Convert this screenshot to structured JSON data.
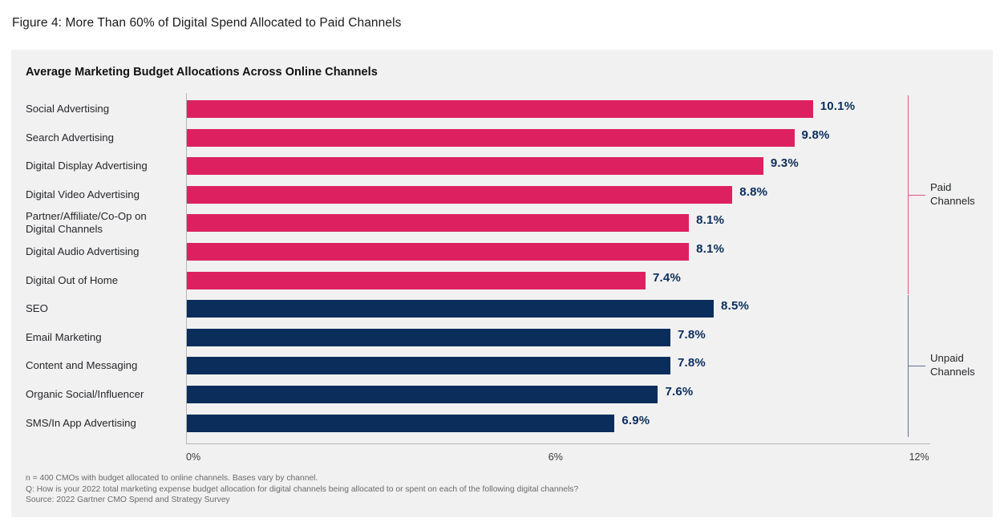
{
  "figure": {
    "caption": "Figure 4: More Than 60% of Digital Spend Allocated to Paid Channels"
  },
  "panel": {
    "title": "Average Marketing Budget Allocations Across Online Channels"
  },
  "colors": {
    "paid": "#DD2160",
    "unpaid": "#0A2D5C",
    "panel_background": "#f1f1f1",
    "paid_bracket": "#E8537F",
    "unpaid_bracket": "#5C7298",
    "axis": "#b6b6b6"
  },
  "brackets": [
    {
      "label": "Paid\nChannels",
      "group": "paid"
    },
    {
      "label": "Unpaid\nChannels",
      "group": "unpaid"
    }
  ],
  "axis": {
    "ticks": [
      "0%",
      "6%",
      "12%"
    ]
  },
  "footnotes": [
    "n = 400 CMOs with budget allocated to online channels. Bases vary by channel.",
    "Q: How is your 2022 total marketing expense budget allocation for digital channels being allocated to or spent on each of the following digital channels?",
    "Source: 2022 Gartner CMO Spend and Strategy Survey"
  ],
  "chart_data": {
    "type": "bar",
    "orientation": "horizontal",
    "title": "Average Marketing Budget Allocations Across Online Channels",
    "xlabel": "",
    "ylabel": "",
    "xlim": [
      0,
      12
    ],
    "xticks": [
      0,
      6,
      12
    ],
    "xtick_labels": [
      "0%",
      "6%",
      "12%"
    ],
    "grid": false,
    "legend": "none",
    "categories": [
      "Social Advertising",
      "Search Advertising",
      "Digital Display Advertising",
      "Digital Video Advertising",
      "Partner/Affiliate/Co-Op on\nDigital Channels",
      "Digital Audio Advertising",
      "Digital Out of Home",
      "SEO",
      "Email Marketing",
      "Content and Messaging",
      "Organic Social/Influencer",
      "SMS/In App Advertising"
    ],
    "values": [
      10.1,
      9.8,
      9.3,
      8.8,
      8.1,
      8.1,
      7.4,
      8.5,
      7.8,
      7.8,
      7.6,
      6.9
    ],
    "value_labels": [
      "10.1%",
      "9.8%",
      "9.3%",
      "8.8%",
      "8.1%",
      "8.1%",
      "7.4%",
      "8.5%",
      "7.8%",
      "7.8%",
      "7.6%",
      "6.9%"
    ],
    "groups": [
      "paid",
      "paid",
      "paid",
      "paid",
      "paid",
      "paid",
      "paid",
      "unpaid",
      "unpaid",
      "unpaid",
      "unpaid",
      "unpaid"
    ],
    "group_labels": {
      "paid": "Paid Channels",
      "unpaid": "Unpaid Channels"
    }
  }
}
